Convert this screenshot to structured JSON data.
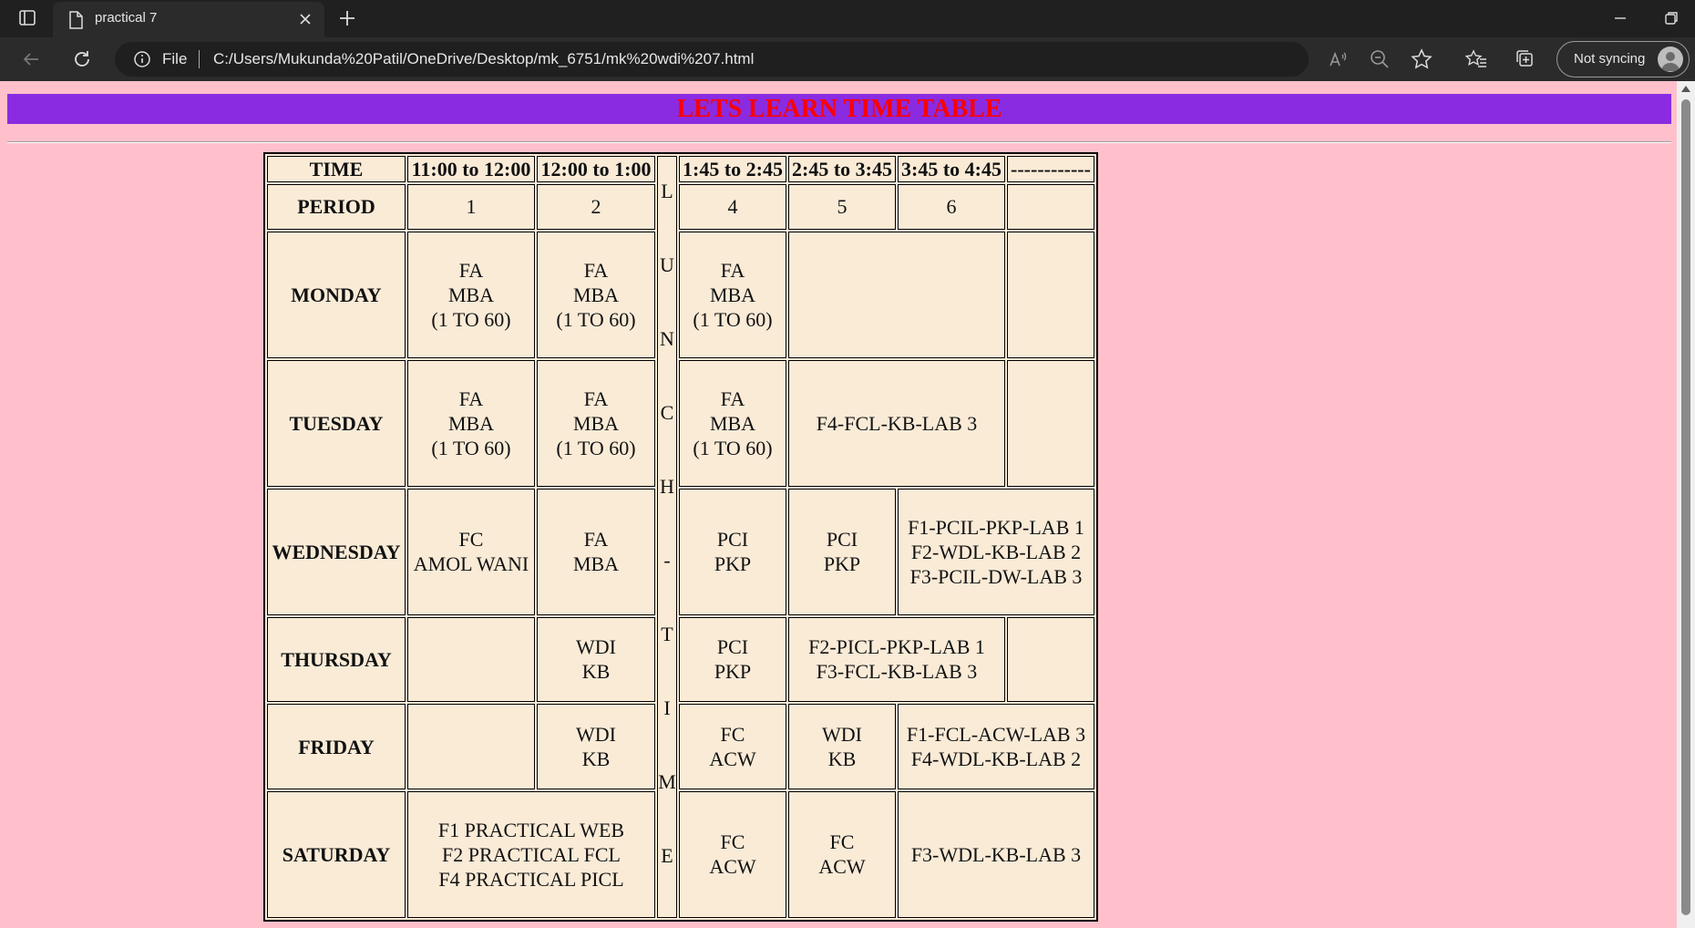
{
  "browser": {
    "tab_title": "practical 7",
    "address_scheme": "File",
    "address_url": "C:/Users/Mukunda%20Patil/OneDrive/Desktop/mk_6751/mk%20wdi%207.html",
    "sync_label": "Not syncing"
  },
  "page": {
    "heading": "LETS LEARN TIME TABLE",
    "colors": {
      "background": "#ffc0cb",
      "banner": "#8a2be2",
      "heading": "#ff0000",
      "table": "#faebd7"
    }
  },
  "timetable": {
    "header": {
      "time_label": "TIME",
      "slots": [
        "11:00 to 12:00",
        "12:00 to 1:00",
        "1:45 to 2:45",
        "2:45 to 3:45",
        "3:45 to 4:45",
        "------------"
      ]
    },
    "period_row": {
      "label": "PERIOD",
      "values": [
        "1",
        "2",
        "4",
        "5",
        "6",
        ""
      ]
    },
    "lunch_letters": [
      "L",
      "U",
      "N",
      "C",
      "H",
      "-",
      "T",
      "I",
      "M",
      "E"
    ],
    "days": {
      "monday": {
        "label": "MONDAY",
        "p1": [
          "FA",
          "MBA",
          "(1 TO 60)"
        ],
        "p2": [
          "FA",
          "MBA",
          "(1 TO 60)"
        ],
        "p4": [
          "FA",
          "MBA",
          "(1 TO 60)"
        ]
      },
      "tuesday": {
        "label": "TUESDAY",
        "p1": [
          "FA",
          "MBA",
          "(1 TO 60)"
        ],
        "p2": [
          "FA",
          "MBA",
          "(1 TO 60)"
        ],
        "p4": [
          "FA",
          "MBA",
          "(1 TO 60)"
        ],
        "p56": "F4-FCL-KB-LAB 3"
      },
      "wednesday": {
        "label": "WEDNESDAY",
        "p1": [
          "FC",
          "AMOL WANI"
        ],
        "p2": [
          "FA",
          "MBA"
        ],
        "p4": [
          "PCI",
          "PKP"
        ],
        "p5": [
          "PCI",
          "PKP"
        ],
        "p6": [
          "F1-PCIL-PKP-LAB 1",
          "F2-WDL-KB-LAB 2",
          "F3-PCIL-DW-LAB 3"
        ]
      },
      "thursday": {
        "label": "THURSDAY",
        "p2": [
          "WDI",
          "KB"
        ],
        "p4": [
          "PCI",
          "PKP"
        ],
        "p56": [
          "F2-PICL-PKP-LAB 1",
          "F3-FCL-KB-LAB 3"
        ]
      },
      "friday": {
        "label": "FRIDAY",
        "p2": [
          "WDI",
          "KB"
        ],
        "p4": [
          "FC",
          "ACW"
        ],
        "p5": [
          "WDI",
          "KB"
        ],
        "p6": [
          "F1-FCL-ACW-LAB 3",
          "F4-WDL-KB-LAB 2"
        ]
      },
      "saturday": {
        "label": "SATURDAY",
        "p12": [
          "F1 PRACTICAL WEB",
          "F2 PRACTICAL FCL",
          "F4 PRACTICAL PICL"
        ],
        "p4": [
          "FC",
          "ACW"
        ],
        "p5": [
          "FC",
          "ACW"
        ],
        "p6": "F3-WDL-KB-LAB 3"
      }
    }
  }
}
